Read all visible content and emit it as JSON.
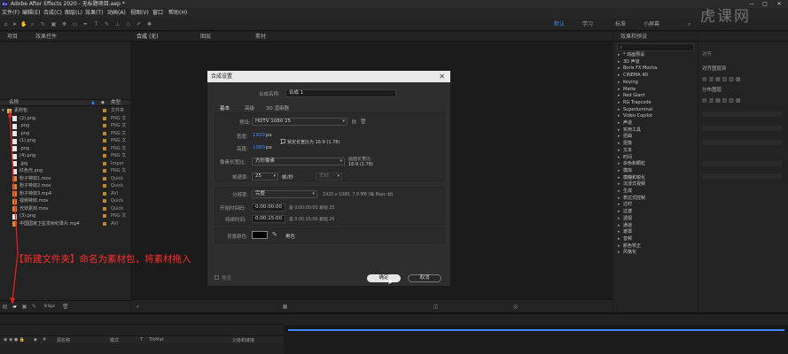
{
  "titlebar": {
    "logo": "Ae",
    "title": "Adobe After Effects 2020 - 无标题项目.aep *",
    "buttons": [
      "—",
      "□",
      "✕"
    ]
  },
  "menubar": {
    "items": [
      "文件(F)",
      "编辑(E)",
      "合成(C)",
      "图层(L)",
      "效果(T)",
      "动画(A)",
      "视图(V)",
      "窗口",
      "帮助(H)"
    ]
  },
  "workspaces": {
    "items": [
      "默认",
      "学习",
      "标准",
      "小屏幕"
    ],
    "active_index": 0
  },
  "project_panel": {
    "tab_label": "项目",
    "effect_controls_tab": "效果控件",
    "col_name": "名称",
    "col_type": "类型",
    "rows": [
      {
        "name": "素材包",
        "type": "文件夹",
        "kind": "folder"
      },
      {
        "name": "(2).png",
        "type": "PNG 文",
        "kind": "img"
      },
      {
        "name": ".png",
        "type": "PNG 文",
        "kind": "img"
      },
      {
        "name": ".png",
        "type": "PNG 文",
        "kind": "img"
      },
      {
        "name": "(1).png",
        "type": "PNG 文",
        "kind": "img"
      },
      {
        "name": ".png",
        "type": "PNG 文",
        "kind": "img"
      },
      {
        "name": "(4).png",
        "type": "PNG 文",
        "kind": "img"
      },
      {
        "name": ".jpg",
        "type": "Impor",
        "kind": "img"
      },
      {
        "name": "红色光.png",
        "type": "PNG 文",
        "kind": "img"
      },
      {
        "name": "粉子特效1.mov",
        "type": "Quick",
        "kind": "vid"
      },
      {
        "name": "粉子特效2.mov",
        "type": "Quick",
        "kind": "vid"
      },
      {
        "name": "粉子特效3.mp4",
        "type": "AVI",
        "kind": "vid"
      },
      {
        "name": "视频特效.mov",
        "type": "Quick",
        "kind": "vid"
      },
      {
        "name": "光效素材.mov",
        "type": "Quick",
        "kind": "vid"
      },
      {
        "name": "(3).png",
        "type": "PNG 文",
        "kind": "img"
      },
      {
        "name": "中国国家卫星发射纪录片.mp4",
        "type": "AVI",
        "kind": "vid"
      }
    ],
    "footer_bpc": "8 bpc"
  },
  "composition_panel": {
    "tab_label": "合成",
    "tab_name": "(无)",
    "layer_tab": "图层",
    "footage_tab": "素材"
  },
  "effects_panel": {
    "title": "效果和预设",
    "items": [
      "* 动画预设",
      "3D 声道",
      "Boris FX Mocha",
      "CINEMA 4D",
      "Keying",
      "Matte",
      "Red Giant",
      "RG Trapcode",
      "Superluminal",
      "Video Copilot",
      "声道",
      "实用工具",
      "扭曲",
      "抠像",
      "文本",
      "时间",
      "杂色和颗粒",
      "模拟",
      "模糊和锐化",
      "沉浸式视频",
      "生成",
      "表达式控制",
      "过时",
      "过渡",
      "透视",
      "通道",
      "遮罩",
      "音频",
      "颜色校正",
      "风格化"
    ]
  },
  "right_panel": {
    "items": [
      "对齐",
      "对齐图层到",
      "分布图层"
    ]
  },
  "dialog": {
    "title": "合成设置",
    "close": "✕",
    "comp_name_label": "合成名称:",
    "comp_name": "合成 1",
    "tabs": [
      "基本",
      "高级",
      "3D 渲染器"
    ],
    "preset_label": "预设:",
    "preset_value": "HDTV 1080 25",
    "width_label": "宽度:",
    "width_value": "1920",
    "width_unit": "px",
    "height_label": "高度:",
    "height_value": "1080",
    "height_unit": "px",
    "lock_label": "锁定长宽比为 16:9 (1.78)",
    "pixel_aspect_label": "像素长宽比:",
    "pixel_aspect_value": "方形像素",
    "frame_aspect_label": "画面长宽比:",
    "frame_aspect_value": "16:9 (1.78)",
    "frame_rate_label": "帧速率:",
    "frame_rate_value": "25",
    "frame_rate_unit": "帧/秒",
    "drop_frame": "丢帧",
    "resolution_label": "分辨率:",
    "resolution_value": "完整",
    "resolution_info": "1920 x 1080, 7.9 MB (每 8bpc 帧)",
    "start_tc_label": "开始时间码:",
    "start_tc_value": "0:00:00:00",
    "start_tc_info": "是 0:00:00:00  基础 25",
    "duration_label": "持续时间:",
    "duration_value": "0:00:15:00",
    "duration_info": "是 0:00:15:00  基础 25",
    "bg_color_label": "背景颜色:",
    "bg_color_name": "黑色",
    "preview_label": "预览",
    "ok": "确定",
    "cancel": "取消"
  },
  "annotation": {
    "text": "【新建文件夹】命名为素材包，将素材拖入"
  },
  "timeline": {
    "col_source": "源名称",
    "col_mode": "模式",
    "col_trkmat": "TrkMat",
    "col_parent": "父级和链接"
  },
  "watermark": "虎课网",
  "colors": {
    "accent": "#3b8bff",
    "annotation": "#ff2b2b",
    "dialog_bg": "#2e2e2e",
    "panel_bg": "#232323"
  }
}
